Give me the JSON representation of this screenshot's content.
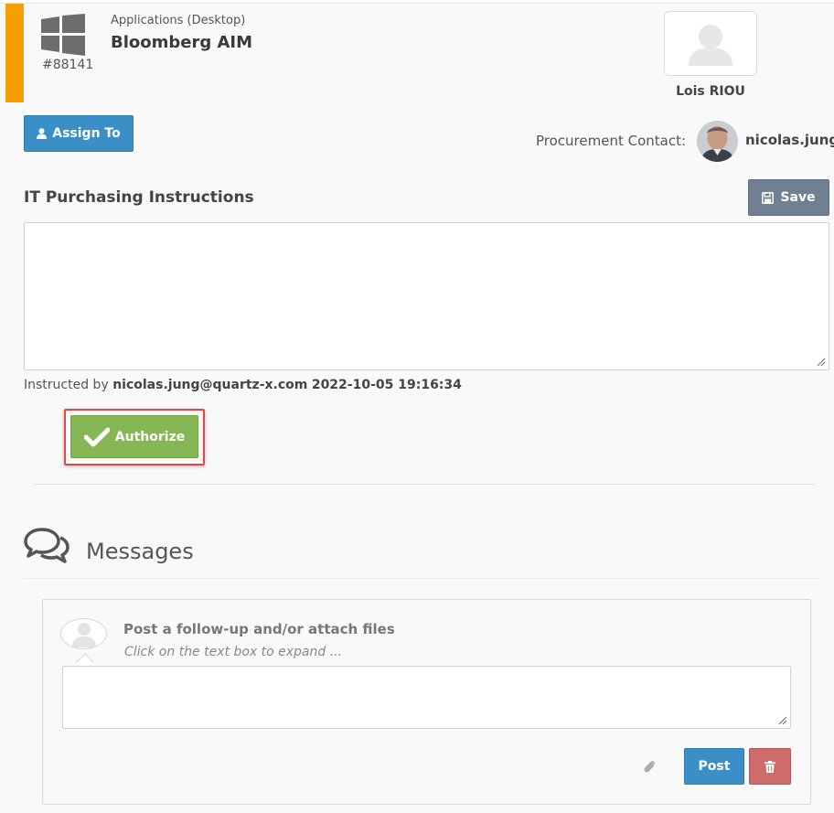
{
  "ticket": {
    "id": "#88141",
    "category": "Applications (Desktop)",
    "name": "Bloomberg AIM",
    "accent_color": "#f5a000",
    "icon": "windows-icon"
  },
  "assignee": {
    "name": "Lois RIOU"
  },
  "actions": {
    "assign_label": "Assign To",
    "save_label": "Save",
    "authorize_label": "Authorize"
  },
  "procurement": {
    "label": "Procurement Contact:",
    "contact_name": "nicolas.jung"
  },
  "instructions": {
    "title": "IT Purchasing Instructions",
    "value": "",
    "instructed_prefix": "Instructed by",
    "instructed_by": "nicolas.jung@quartz-x.com",
    "instructed_at": "2022-10-05 19:16:34"
  },
  "messages": {
    "title": "Messages",
    "post_hint": "Post a follow-up and/or attach files",
    "expand_hint": "Click on the text box to expand ...",
    "value": "",
    "post_label": "Post"
  },
  "colors": {
    "primary": "#3a8fc6",
    "success": "#87b754",
    "danger": "#cf6b6b",
    "neutral": "#6f8092",
    "highlight": "#e4474b"
  }
}
